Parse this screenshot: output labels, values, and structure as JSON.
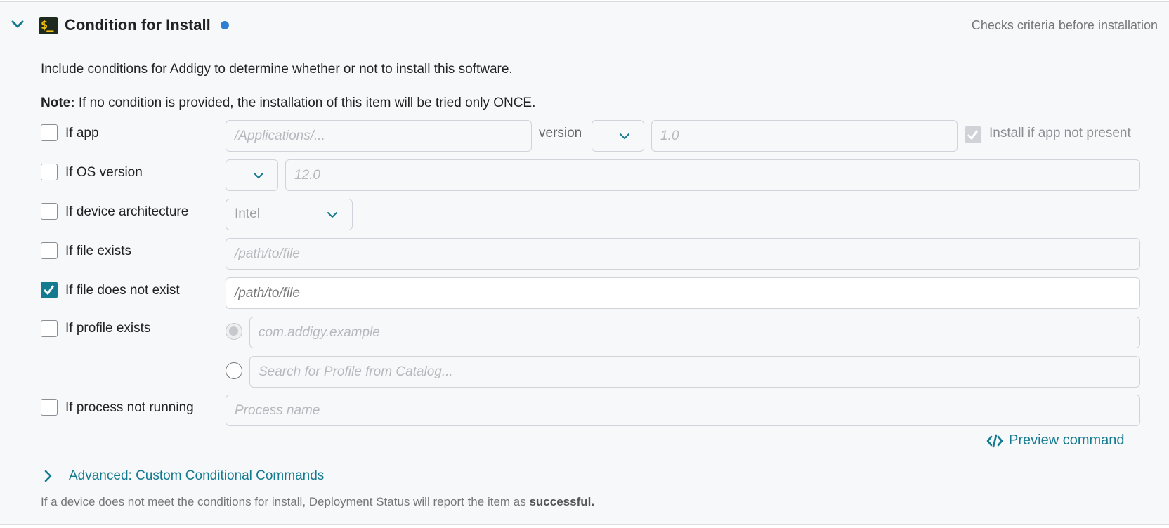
{
  "header": {
    "title": "Condition for Install",
    "subtitle": "Checks criteria before installation",
    "terminal_glyph": "$_",
    "status_color": "#2c7fd1"
  },
  "description": "Include conditions for Addigy to determine whether or not to install this software.",
  "note": {
    "prefix": "Note:",
    "text": " If no condition is provided, the installation of this item will be tried only ONCE."
  },
  "conditions": {
    "app": {
      "label": "If app",
      "checked": false,
      "path_placeholder": "/Applications/...",
      "version_label": "version",
      "version_placeholder": "1.0",
      "install_if_not_present_label": "Install if app not present",
      "install_if_not_present_checked": true
    },
    "os_version": {
      "label": "If OS version",
      "checked": false,
      "placeholder": "12.0"
    },
    "device_architecture": {
      "label": "If device architecture",
      "checked": false,
      "selected": "Intel"
    },
    "file_exists": {
      "label": "If file exists",
      "checked": false,
      "placeholder": "/path/to/file"
    },
    "file_not_exist": {
      "label": "If file does not exist",
      "checked": true,
      "value": "/path/to/file"
    },
    "profile_exists": {
      "label": "If profile exists",
      "checked": false,
      "identifier_placeholder": "com.addigy.example",
      "catalog_placeholder": "Search for Profile from Catalog..."
    },
    "process_not_running": {
      "label": "If process not running",
      "checked": false,
      "placeholder": "Process name"
    }
  },
  "actions": {
    "preview_command": "Preview command",
    "advanced": "Advanced: Custom Conditional Commands"
  },
  "footer": {
    "text": "If a device does not meet the conditions for install, Deployment Status will report the item as ",
    "emphasis": "successful."
  },
  "colors": {
    "accent": "#137a8f",
    "panel_bg": "#f7f8fa"
  }
}
